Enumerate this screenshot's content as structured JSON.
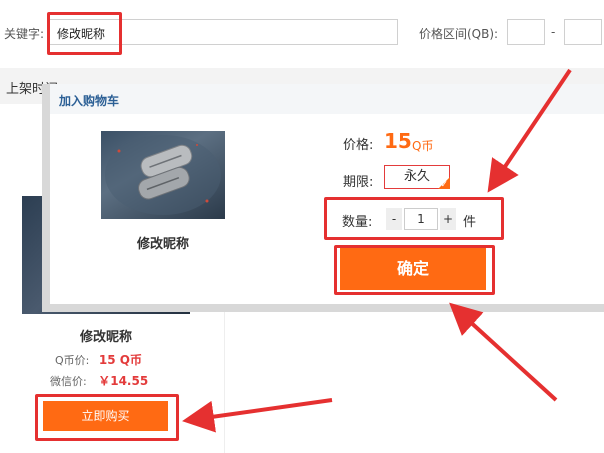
{
  "filter": {
    "keyword_label": "关键字:",
    "keyword_value": "修改昵称",
    "price_range_label": "价格区间(QB):",
    "price_sep": "-"
  },
  "sort_bar": {
    "label": "上架时间"
  },
  "product": {
    "name": "修改昵称",
    "qb_price_label": "Q币价:",
    "qb_price_value": "15 Q币",
    "wx_price_label": "微信价:",
    "wx_price_value": "￥14.55",
    "buy_label": "立即购买"
  },
  "modal": {
    "title": "加入购物车",
    "product_name": "修改昵称",
    "price_label": "价格:",
    "price_value": "15",
    "price_unit": "Q币",
    "period_label": "期限:",
    "period_value": "永久",
    "qty_label": "数量:",
    "qty_minus": "-",
    "qty_value": "1",
    "qty_plus": "+",
    "qty_unit": "件",
    "confirm_label": "确定"
  },
  "colors": {
    "accent": "#ff6a13",
    "annotation": "#e53030",
    "title": "#2b5f95"
  },
  "icons": [
    "check-corner-icon",
    "tag-dogtags-image"
  ]
}
